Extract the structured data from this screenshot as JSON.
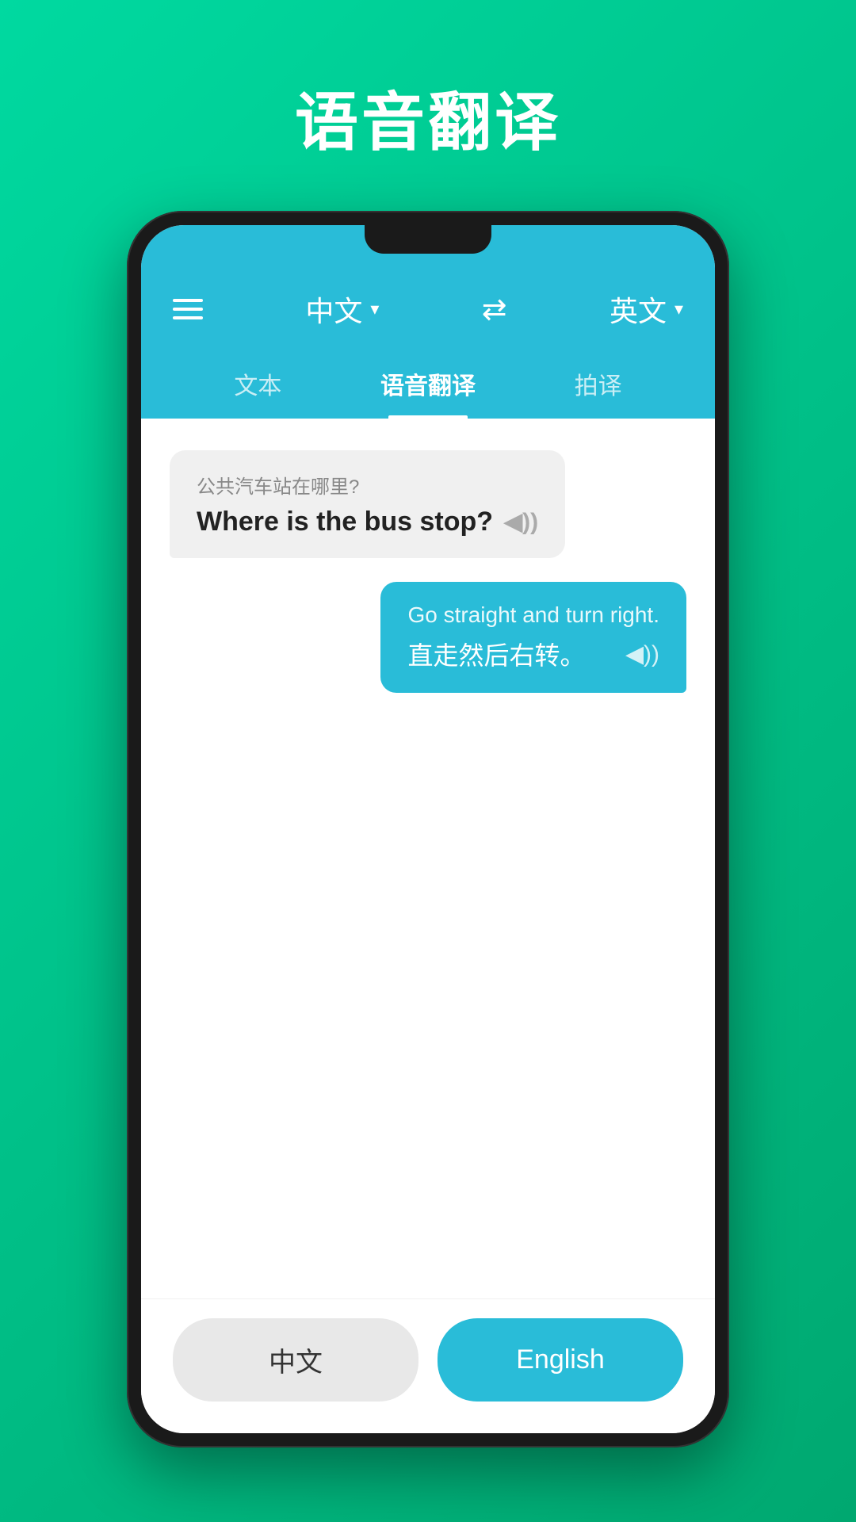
{
  "page": {
    "title": "语音翻译",
    "background_start": "#00d9a0",
    "background_end": "#00a870"
  },
  "header": {
    "source_lang": "中文",
    "source_lang_arrow": "▾",
    "target_lang": "英文",
    "target_lang_arrow": "▾",
    "swap_icon": "⇄"
  },
  "tabs": [
    {
      "id": "text",
      "label": "文本",
      "active": false
    },
    {
      "id": "voice",
      "label": "语音翻译",
      "active": true
    },
    {
      "id": "photo",
      "label": "拍译",
      "active": false
    }
  ],
  "messages": [
    {
      "direction": "left",
      "original": "公共汽车站在哪里?",
      "translated": "Where is the bus stop?",
      "sound": "◀))"
    },
    {
      "direction": "right",
      "original": "Go straight and turn right.",
      "translated": "直走然后右转。",
      "sound": "◀))"
    }
  ],
  "bottom_buttons": {
    "chinese_label": "中文",
    "english_label": "English"
  }
}
